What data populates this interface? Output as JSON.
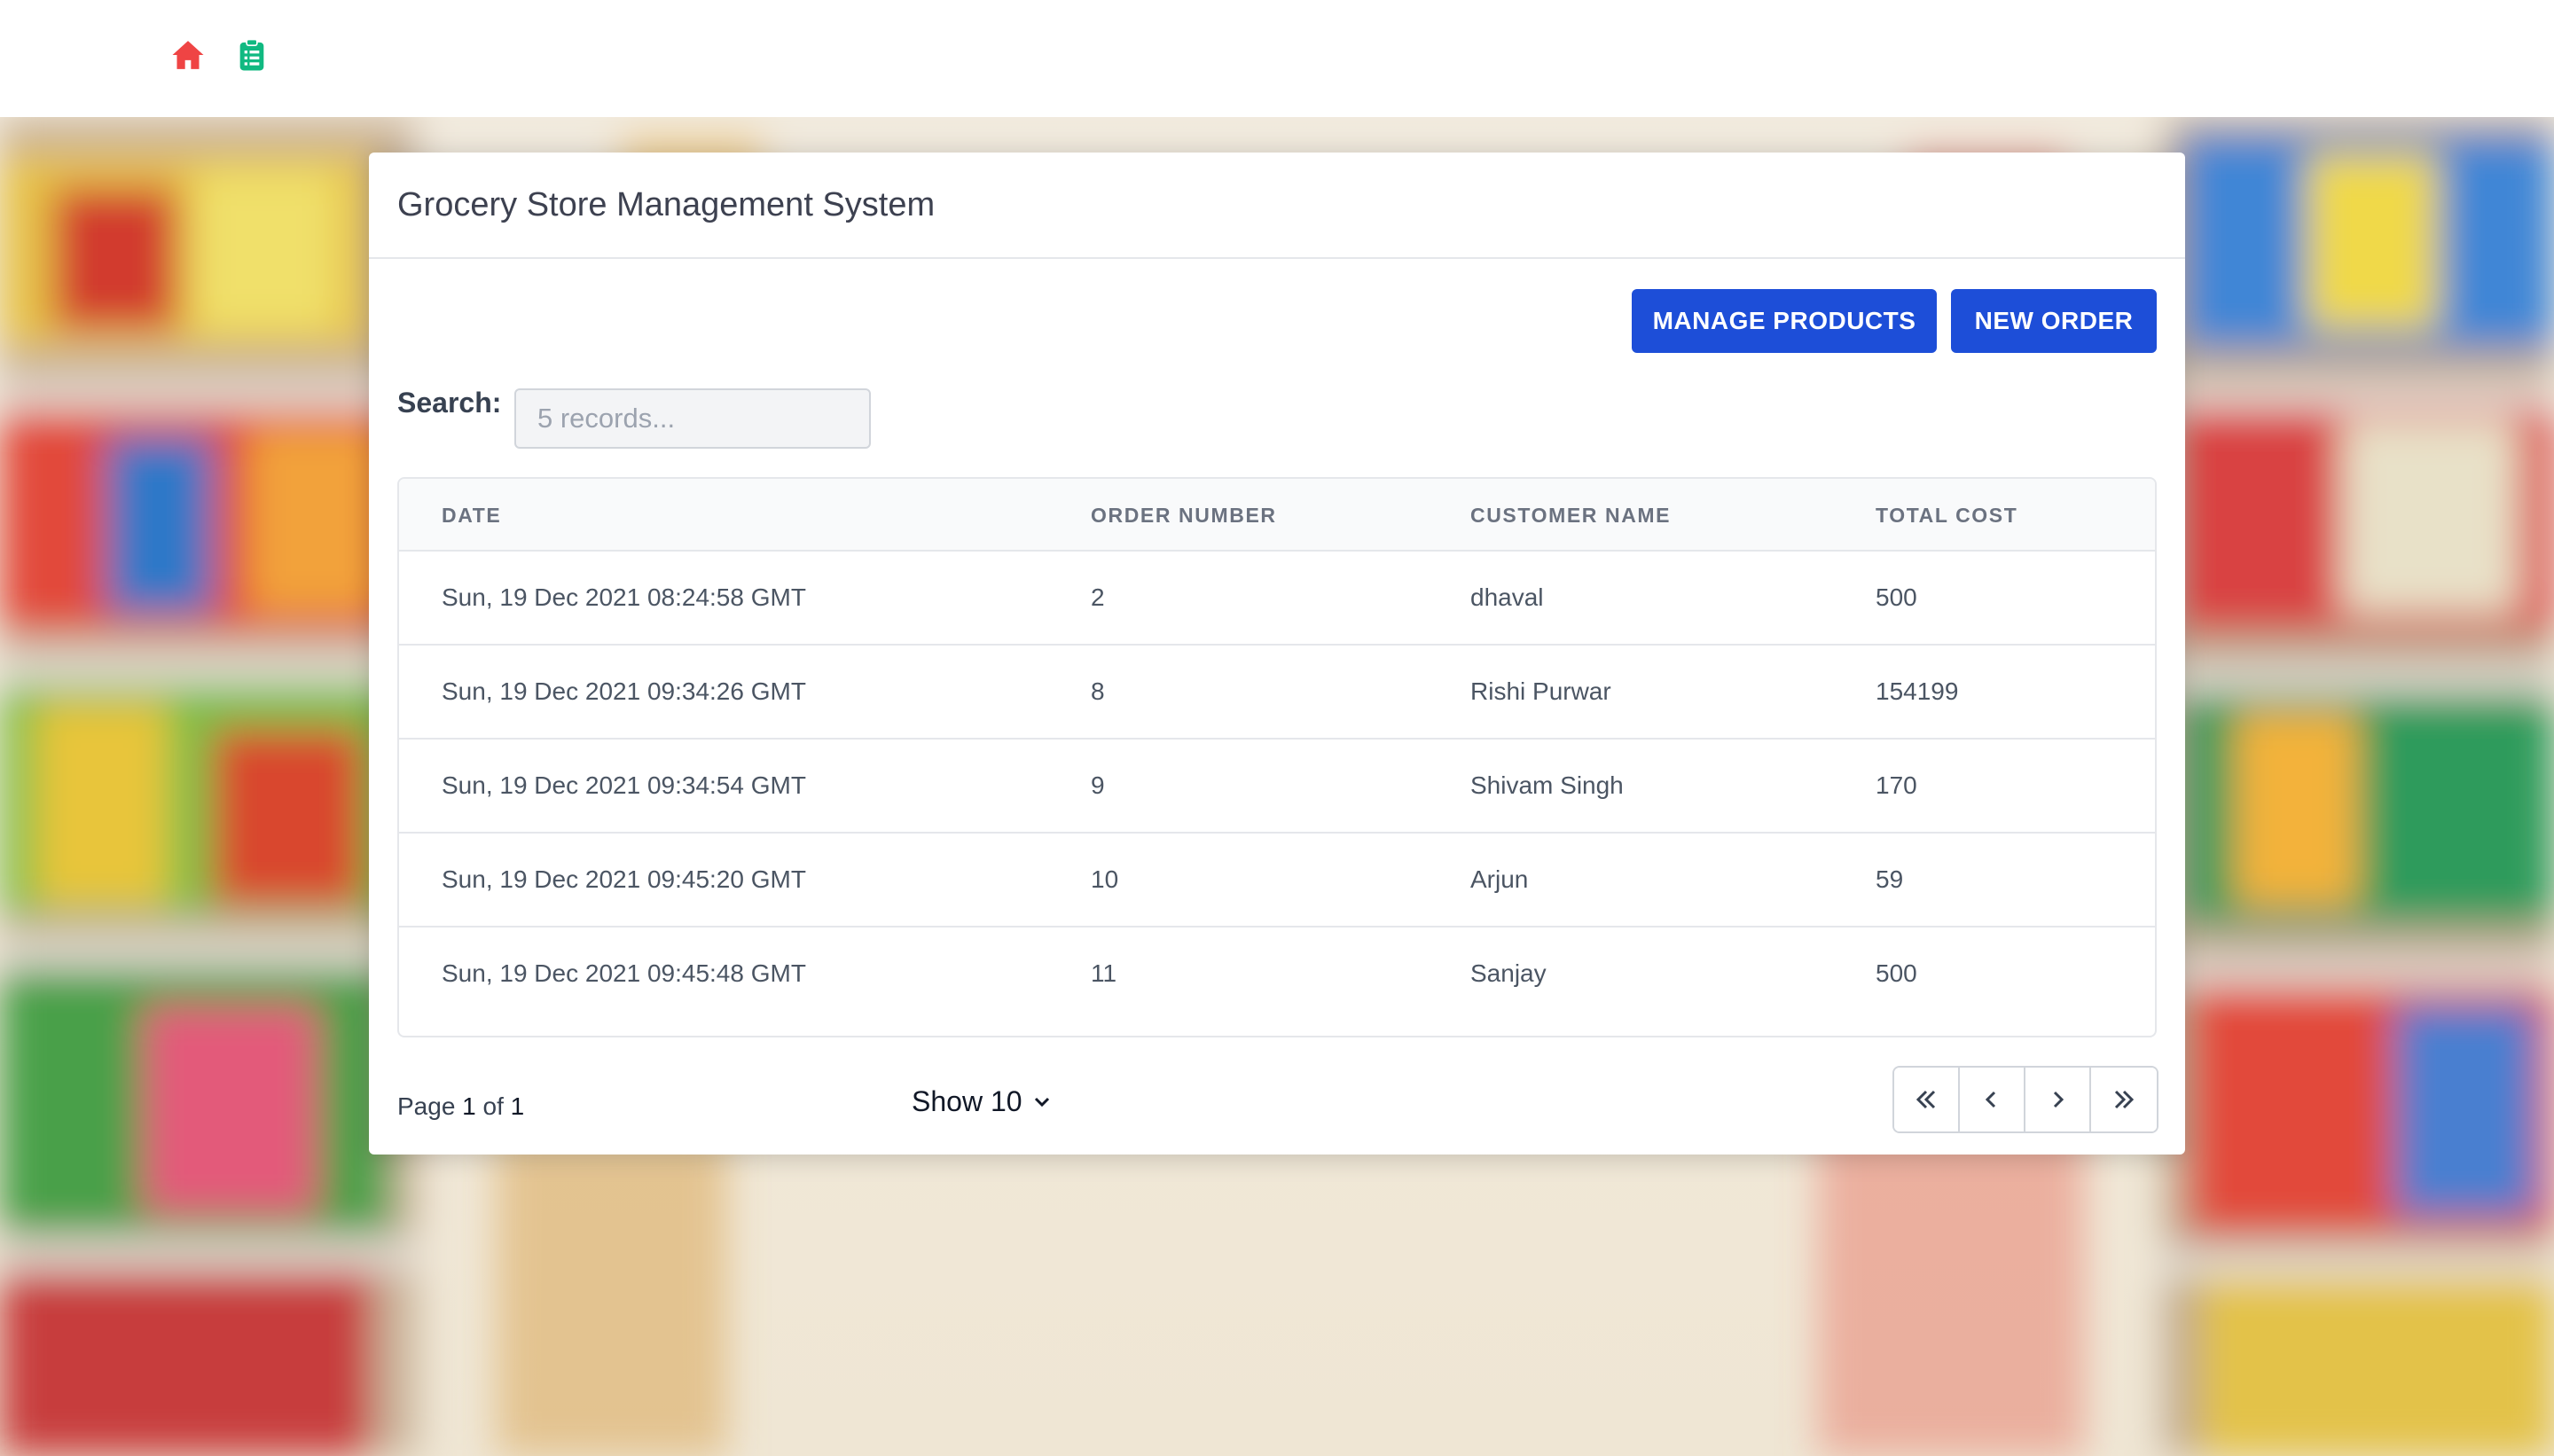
{
  "nav": {
    "icons": [
      "home-icon",
      "clipboard-list-icon"
    ],
    "home_color": "#ef4444",
    "orders_color": "#10b981"
  },
  "card": {
    "title": "Grocery Store Management System",
    "manage_products_label": "MANAGE PRODUCTS",
    "new_order_label": "NEW ORDER",
    "accent_color": "#1d4ed8"
  },
  "search": {
    "label": "Search:",
    "placeholder": "5 records..."
  },
  "table": {
    "headers": [
      "DATE",
      "ORDER NUMBER",
      "CUSTOMER NAME",
      "TOTAL COST"
    ],
    "rows": [
      {
        "date": "Sun, 19 Dec 2021 08:24:58 GMT",
        "order_number": "2",
        "customer_name": "dhaval",
        "total_cost": "500"
      },
      {
        "date": "Sun, 19 Dec 2021 09:34:26 GMT",
        "order_number": "8",
        "customer_name": "Rishi Purwar",
        "total_cost": "154199"
      },
      {
        "date": "Sun, 19 Dec 2021 09:34:54 GMT",
        "order_number": "9",
        "customer_name": "Shivam Singh",
        "total_cost": "170"
      },
      {
        "date": "Sun, 19 Dec 2021 09:45:20 GMT",
        "order_number": "10",
        "customer_name": "Arjun",
        "total_cost": "59"
      },
      {
        "date": "Sun, 19 Dec 2021 09:45:48 GMT",
        "order_number": "11",
        "customer_name": "Sanjay",
        "total_cost": "500"
      }
    ]
  },
  "pagination": {
    "page_prefix": "Page ",
    "current_page": "1",
    "of_text": " of ",
    "total_pages": "1",
    "show_label": "Show 10",
    "buttons": [
      "double-chevron-left-icon",
      "chevron-left-icon",
      "chevron-right-icon",
      "double-chevron-right-icon"
    ]
  }
}
